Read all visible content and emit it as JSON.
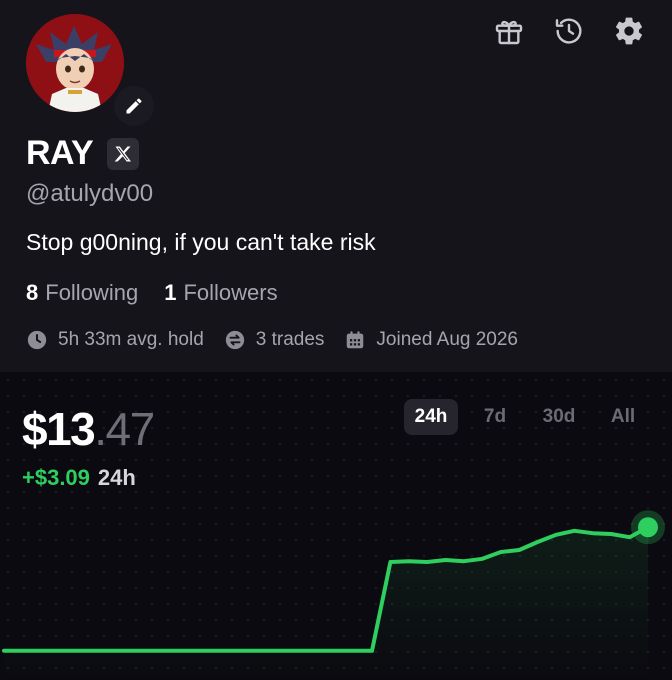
{
  "profile": {
    "name": "RAY",
    "handle": "@atulydv00",
    "bio": "Stop g00ning, if you can't take risk",
    "following_count": "8",
    "following_label": "Following",
    "followers_count": "1",
    "followers_label": "Followers",
    "stats": {
      "avg_hold": "5h 33m avg. hold",
      "trades": "3 trades",
      "joined": "Joined Aug 2026"
    }
  },
  "header_icons": [
    "gift-icon",
    "history-icon",
    "gear-icon"
  ],
  "portfolio": {
    "value_main": "$13",
    "value_cents": ".47",
    "change": "+$3.09",
    "change_period": "24h",
    "ranges": [
      "24h",
      "7d",
      "30d",
      "All"
    ],
    "selected_range": "24h"
  },
  "colors": {
    "accent_green": "#2ecf5e",
    "background": "#15141b",
    "chart_background": "#0b0a10",
    "avatar_red": "#8e0f14"
  },
  "chart_data": {
    "type": "line",
    "title": "",
    "xlabel": "",
    "ylabel": "",
    "x": [
      0,
      1,
      2,
      3,
      4,
      5,
      6,
      7,
      8,
      9,
      10,
      11,
      12,
      13,
      14,
      15,
      16,
      17,
      18,
      19,
      20,
      21,
      22,
      23,
      24,
      25,
      26,
      27,
      28,
      29,
      30,
      31,
      32,
      33,
      34,
      35
    ],
    "series": [
      {
        "values": [
          10.38,
          10.38,
          10.38,
          10.38,
          10.38,
          10.38,
          10.38,
          10.38,
          10.38,
          10.38,
          10.38,
          10.38,
          10.38,
          10.38,
          10.38,
          10.38,
          10.38,
          10.38,
          10.38,
          10.38,
          10.38,
          12.6,
          12.62,
          12.6,
          12.65,
          12.62,
          12.68,
          12.85,
          12.9,
          13.1,
          13.28,
          13.38,
          13.32,
          13.3,
          13.22,
          13.47
        ]
      }
    ],
    "ylim": [
      10.2,
      13.6
    ],
    "grid": false,
    "endpoint_marker": true
  }
}
